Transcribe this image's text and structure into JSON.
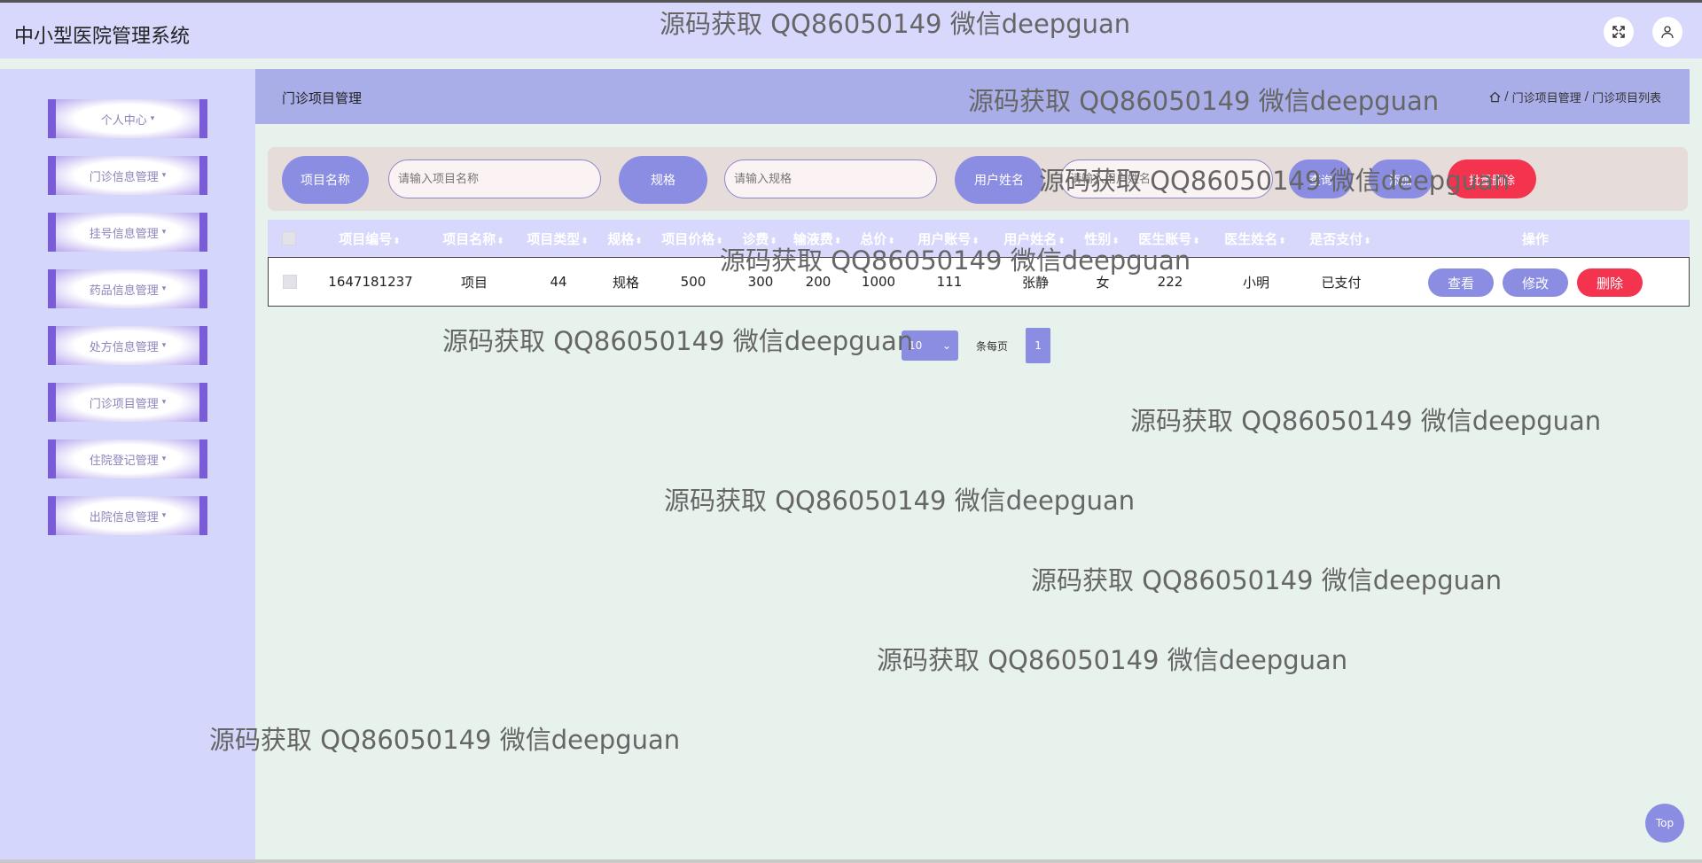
{
  "app": {
    "title": "中小型医院管理系统"
  },
  "header": {
    "fullscreen_icon": "expand-icon",
    "user_icon": "user-icon"
  },
  "sidebar": {
    "items": [
      {
        "label": "个人中心"
      },
      {
        "label": "门诊信息管理"
      },
      {
        "label": "挂号信息管理"
      },
      {
        "label": "药品信息管理"
      },
      {
        "label": "处方信息管理"
      },
      {
        "label": "门诊项目管理"
      },
      {
        "label": "住院登记管理"
      },
      {
        "label": "出院信息管理"
      }
    ],
    "caret": "▾"
  },
  "main": {
    "section_title": "门诊项目管理",
    "breadcrumb": {
      "sep1": "/",
      "level1": "门诊项目管理",
      "sep2": "/",
      "level2": "门诊项目列表"
    }
  },
  "search": {
    "project_name_label": "项目名称",
    "project_name_placeholder": "请输入项目名称",
    "spec_label": "规格",
    "spec_placeholder": "请输入规格",
    "user_name_label": "用户姓名",
    "user_name_placeholder": "请输入用户姓名",
    "query_button": "查询",
    "add_button": "添加",
    "batch_delete_button": "批量删除"
  },
  "table": {
    "columns": [
      "项目编号",
      "项目名称",
      "项目类型",
      "规格",
      "项目价格",
      "诊费",
      "输液费",
      "总价",
      "用户账号",
      "用户姓名",
      "性别",
      "医生账号",
      "医生姓名",
      "是否支付",
      "操作"
    ],
    "sort_glyph": "⬍",
    "rows": [
      {
        "cells": [
          "1647181237",
          "项目",
          "44",
          "规格",
          "500",
          "300",
          "200",
          "1000",
          "111",
          "张静",
          "女",
          "222",
          "小明",
          "已支付"
        ],
        "view": "查看",
        "edit": "修改",
        "delete": "删除"
      }
    ]
  },
  "pagination": {
    "page_size": "10",
    "per_page_label": "条每页",
    "current_page": "1"
  },
  "top_button": "Top",
  "watermark": "源码获取 QQ86050149 微信deepguan"
}
